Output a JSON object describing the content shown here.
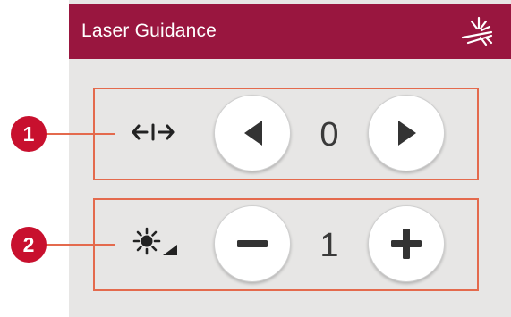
{
  "window": {
    "title": "Laser Guidance",
    "header_color": "#99163f",
    "title_icon": "laser-icon"
  },
  "rows": [
    {
      "callout": "1",
      "icon": "position-arrows-icon",
      "value": "0",
      "decrease_icon": "arrow-left-icon",
      "increase_icon": "arrow-right-icon"
    },
    {
      "callout": "2",
      "icon": "brightness-icon",
      "value": "1",
      "decrease_icon": "minus-icon",
      "increase_icon": "plus-icon"
    }
  ],
  "colors": {
    "callout_badge": "#c8102e",
    "callout_outline": "#e46a4d",
    "panel_background": "#e7e6e5"
  }
}
